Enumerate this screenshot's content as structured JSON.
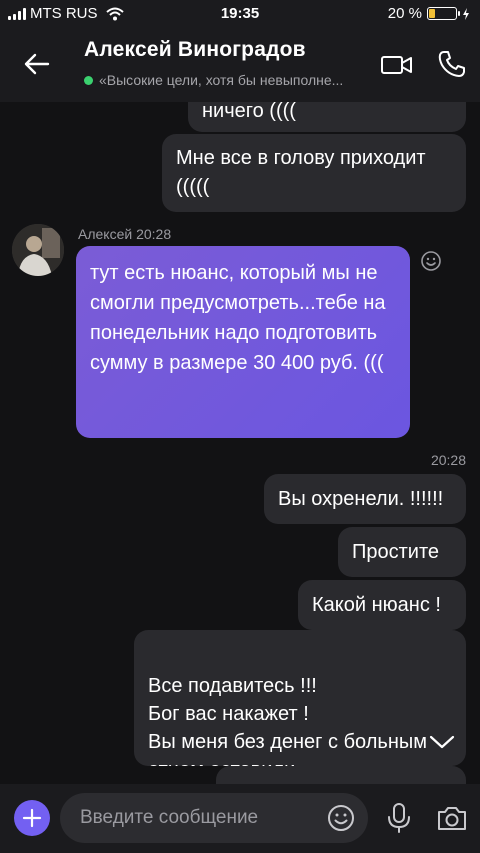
{
  "status_bar": {
    "carrier": "MTS RUS",
    "time": "19:35",
    "battery": "20 %"
  },
  "header": {
    "contact_name": "Алексей Виноградов",
    "status_text": "«Высокие цели, хотя бы невыполне..."
  },
  "messages": {
    "prev_partial": "ничего ((((",
    "out_1": "Мне все в голову приходит (((((",
    "incoming_sender": "Алексей 20:28",
    "incoming_text": "тут есть нюанс, который мы не смогли предусмотреть...тебе на понедельник надо подготовить сумму в размере 30 400 руб. (((",
    "outgoing_time": "20:28",
    "out_2": "Вы охренели. !!!!!!",
    "out_3": "Простите",
    "out_4": "Какой нюанс !",
    "out_5": "Все подавитесь !!!\nБог вас накажет !\nВы меня без денег с больным отцом оставили."
  },
  "input": {
    "placeholder": "Введите сообщение"
  },
  "colors": {
    "accent": "#7360f2",
    "online": "#3bd16f",
    "bubble_out": "#2a2a2e",
    "background": "#121214"
  }
}
